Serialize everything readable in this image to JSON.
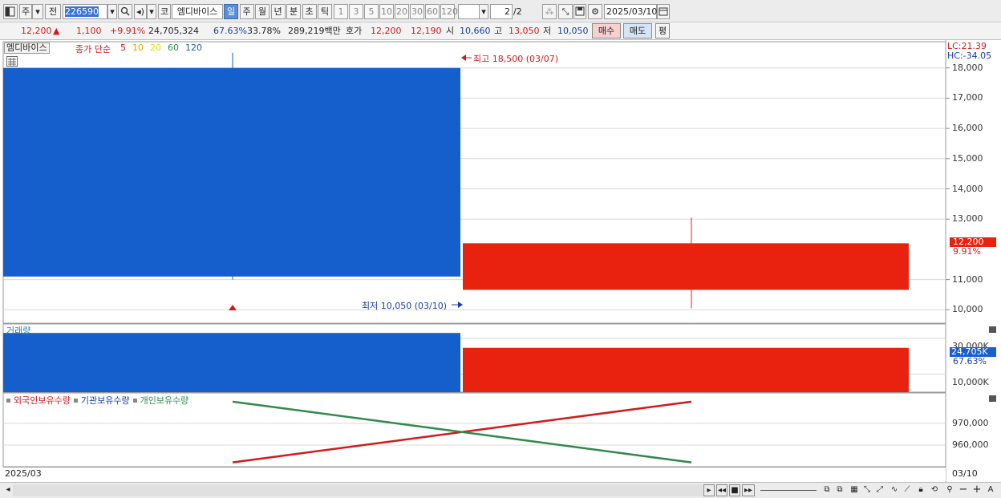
{
  "toolbar": {
    "code": "226590",
    "stock_name": "엠디바이스",
    "market_label": "주",
    "prev_label": "전",
    "kospi_label": "코",
    "periods": [
      "일",
      "주",
      "월",
      "년",
      "분",
      "초",
      "틱"
    ],
    "period_selected": "일",
    "intervals": [
      "1",
      "3",
      "5",
      "10",
      "20",
      "30",
      "60",
      "120"
    ],
    "page_current": "2",
    "page_total": "/2",
    "date": "2025/03/10"
  },
  "info": {
    "price": "12,200",
    "price_arrow": "▲",
    "change": "1,100",
    "change_pct": "+9.91%",
    "volume": "24,705,324",
    "volume_ratio": "67.63%",
    "turnover": "33.78%",
    "amount": "289,219백만",
    "bid_label": "호가",
    "ask": "12,200",
    "bid": "12,190",
    "open_label": "시",
    "open": "10,660",
    "high_label": "고",
    "high": "13,050",
    "low_label": "저",
    "low": "10,050",
    "buy_label": "매수",
    "sell_label": "매도",
    "avg_label": "평"
  },
  "chart": {
    "legend_stock": "엠디바이스",
    "legend_ma": "종가 단순",
    "ma_periods": [
      "5",
      "10",
      "20",
      "60",
      "120"
    ],
    "ma_colors": [
      "#d21a1a",
      "#e0a800",
      "#e0e000",
      "#2f8a4a",
      "#1a5fb4"
    ],
    "lc": "LC:21.39",
    "hc": "HC:-34.05",
    "high_note": "최고 18,500 (03/07)",
    "low_note": "최저 10,050 (03/10)",
    "last_price_badge": "12,200",
    "last_pct": "9.91%",
    "price_ticks": [
      "18,000",
      "17,000",
      "16,000",
      "15,000",
      "14,000",
      "13,000",
      "11,000",
      "10,000"
    ],
    "volume_title": "거래량",
    "volume_ticks": [
      "30,000K",
      "10,000K"
    ],
    "volume_badge": "24,705K",
    "volume_pct": "67.63%",
    "holding_legend": [
      "외국인보유수량",
      "기관보유수량",
      "개인보유수량"
    ],
    "holding_colors": [
      "#d21a1a",
      "#1a3fa0",
      "#2f8a4a"
    ],
    "holding_ticks": [
      "970,000",
      "960,000"
    ],
    "x_left": "2025/03",
    "x_right": "03/10",
    "up_color": "#e8220e",
    "down_color": "#155fcc"
  },
  "chart_data": {
    "type": "candlestick",
    "categories": [
      "03/07",
      "03/10"
    ],
    "price": [
      {
        "date": "03/07",
        "open": 18000,
        "high": 18500,
        "low": 11000,
        "close": 11100
      },
      {
        "date": "03/10",
        "open": 10660,
        "high": 13050,
        "low": 10050,
        "close": 12200
      }
    ],
    "volume": [
      {
        "date": "03/07",
        "value": 33000000
      },
      {
        "date": "03/10",
        "value": 24705324
      }
    ],
    "holding_series": [
      {
        "name": "외국인보유수량",
        "values": [
          952000,
          980000
        ]
      },
      {
        "name": "개인보유수량",
        "values": [
          980000,
          952000
        ]
      }
    ],
    "price_ylim": [
      9000,
      19000
    ]
  }
}
